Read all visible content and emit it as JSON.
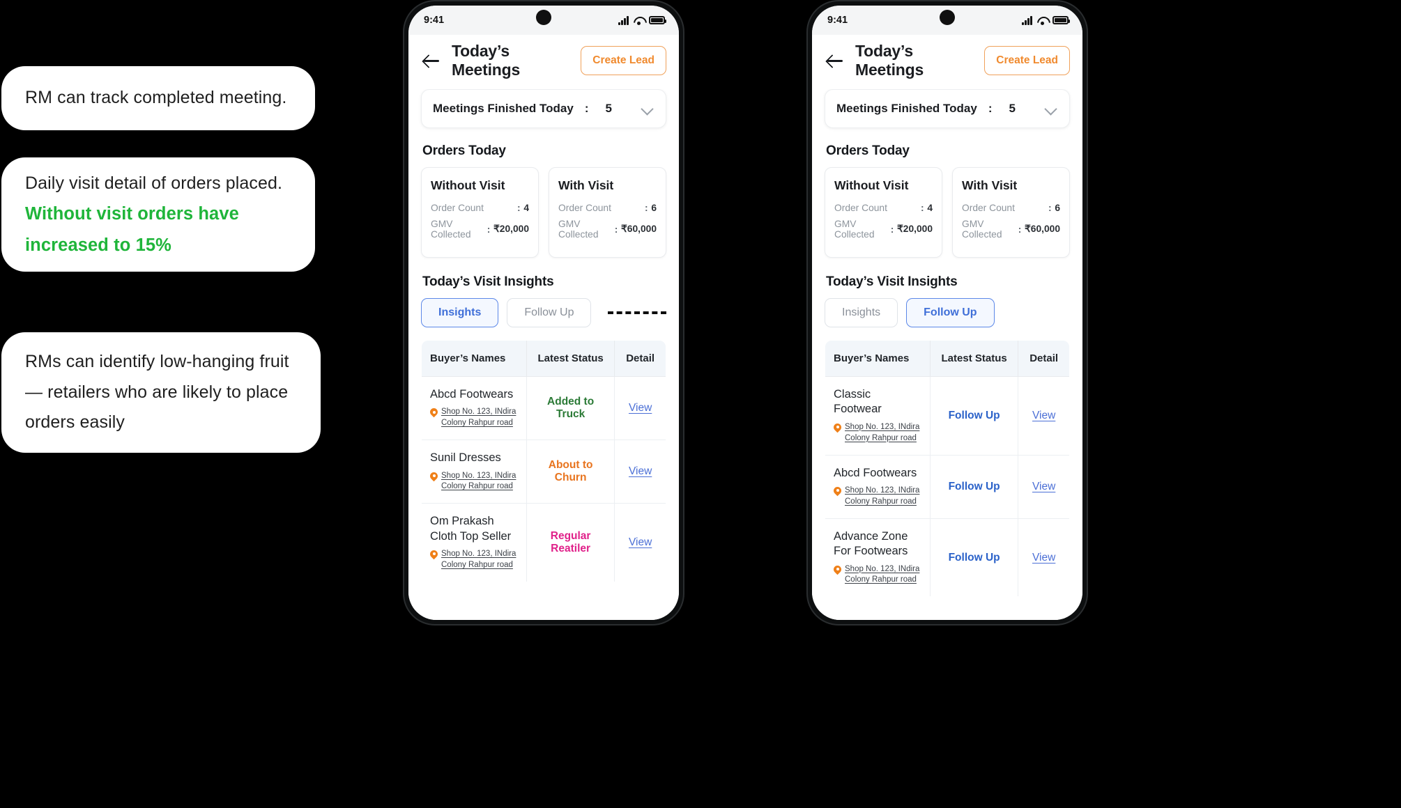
{
  "callouts": [
    {
      "text": "RM can track completed meeting."
    },
    {
      "text": "Daily visit detail of orders placed.",
      "highlight": "Without visit orders have increased to 15%",
      "highlight_color": "#1fb53a"
    },
    {
      "text": "RMs can identify low-hanging fruit — retailers who are likely to place orders easily"
    }
  ],
  "phones": [
    {
      "status_bar": {
        "time": "9:41",
        "signal_icon": "cellular-bars-icon",
        "wifi_icon": "wifi-icon",
        "battery_icon": "battery-icon"
      },
      "appbar": {
        "back_icon": "back-arrow-icon",
        "title": "Today’s Meetings",
        "action_label": "Create Lead"
      },
      "meetings_card": {
        "label": "Meetings Finished Today",
        "separator": ":",
        "value": "5",
        "chevron_icon": "chevron-down-icon"
      },
      "orders_section": {
        "title": "Orders Today",
        "cards": [
          {
            "title": "Without Visit",
            "rows": [
              {
                "key": "Order Count",
                "sep": ":",
                "value": "4"
              },
              {
                "key": "GMV Collected",
                "sep": ":",
                "value": "₹20,000"
              }
            ]
          },
          {
            "title": "With Visit",
            "rows": [
              {
                "key": "Order Count",
                "sep": ":",
                "value": "6"
              },
              {
                "key": "GMV Collected",
                "sep": ":",
                "value": "₹60,000"
              }
            ]
          }
        ]
      },
      "insights_section": {
        "title": "Today’s Visit Insights",
        "tabs": [
          {
            "label": "Insights",
            "active": true
          },
          {
            "label": "Follow Up",
            "active": false
          }
        ],
        "dashed_connector": true,
        "table": {
          "headers": [
            "Buyer’s Names",
            "Latest Status",
            "Detail"
          ],
          "rows": [
            {
              "name": "Abcd Footwears",
              "address": "Shop No. 123, INdira Colony Rahpur road",
              "pin_icon": "location-pin-icon",
              "status": "Added to Truck",
              "status_color": "#2b7a36",
              "detail": "View"
            },
            {
              "name": "Sunil Dresses",
              "address": "Shop No. 123, INdira Colony Rahpur road",
              "pin_icon": "location-pin-icon",
              "status": "About to Churn",
              "status_color": "#e8741e",
              "detail": "View"
            },
            {
              "name": "Om Prakash Cloth Top Seller",
              "address": "Shop No. 123, INdira Colony Rahpur road",
              "pin_icon": "location-pin-icon",
              "status": "Regular Reatiler",
              "status_color": "#e0218a",
              "detail": "View"
            }
          ]
        }
      }
    },
    {
      "status_bar": {
        "time": "9:41",
        "signal_icon": "cellular-bars-icon",
        "wifi_icon": "wifi-icon",
        "battery_icon": "battery-icon"
      },
      "appbar": {
        "back_icon": "back-arrow-icon",
        "title": "Today’s Meetings",
        "action_label": "Create Lead"
      },
      "meetings_card": {
        "label": "Meetings Finished Today",
        "separator": ":",
        "value": "5",
        "chevron_icon": "chevron-down-icon"
      },
      "orders_section": {
        "title": "Orders Today",
        "cards": [
          {
            "title": "Without Visit",
            "rows": [
              {
                "key": "Order Count",
                "sep": ":",
                "value": "4"
              },
              {
                "key": "GMV Collected",
                "sep": ":",
                "value": "₹20,000"
              }
            ]
          },
          {
            "title": "With Visit",
            "rows": [
              {
                "key": "Order Count",
                "sep": ":",
                "value": "6"
              },
              {
                "key": "GMV Collected",
                "sep": ":",
                "value": "₹60,000"
              }
            ]
          }
        ]
      },
      "insights_section": {
        "title": "Today’s Visit Insights",
        "tabs": [
          {
            "label": "Insights",
            "active": false
          },
          {
            "label": "Follow Up",
            "active": true
          }
        ],
        "dashed_connector": false,
        "table": {
          "headers": [
            "Buyer’s Names",
            "Latest Status",
            "Detail"
          ],
          "rows": [
            {
              "name": "Classic Footwear",
              "address": "Shop No. 123, INdira Colony Rahpur road",
              "pin_icon": "location-pin-icon",
              "status": "Follow Up",
              "status_color": "#2b62c9",
              "detail": "View"
            },
            {
              "name": "Abcd Footwears",
              "address": "Shop No. 123, INdira Colony Rahpur road",
              "pin_icon": "location-pin-icon",
              "status": "Follow Up",
              "status_color": "#2b62c9",
              "detail": "View"
            },
            {
              "name": "Advance Zone For Footwears",
              "address": "Shop No. 123, INdira Colony Rahpur road",
              "pin_icon": "location-pin-icon",
              "status": "Follow Up",
              "status_color": "#2b62c9",
              "detail": "View"
            }
          ]
        }
      }
    }
  ]
}
